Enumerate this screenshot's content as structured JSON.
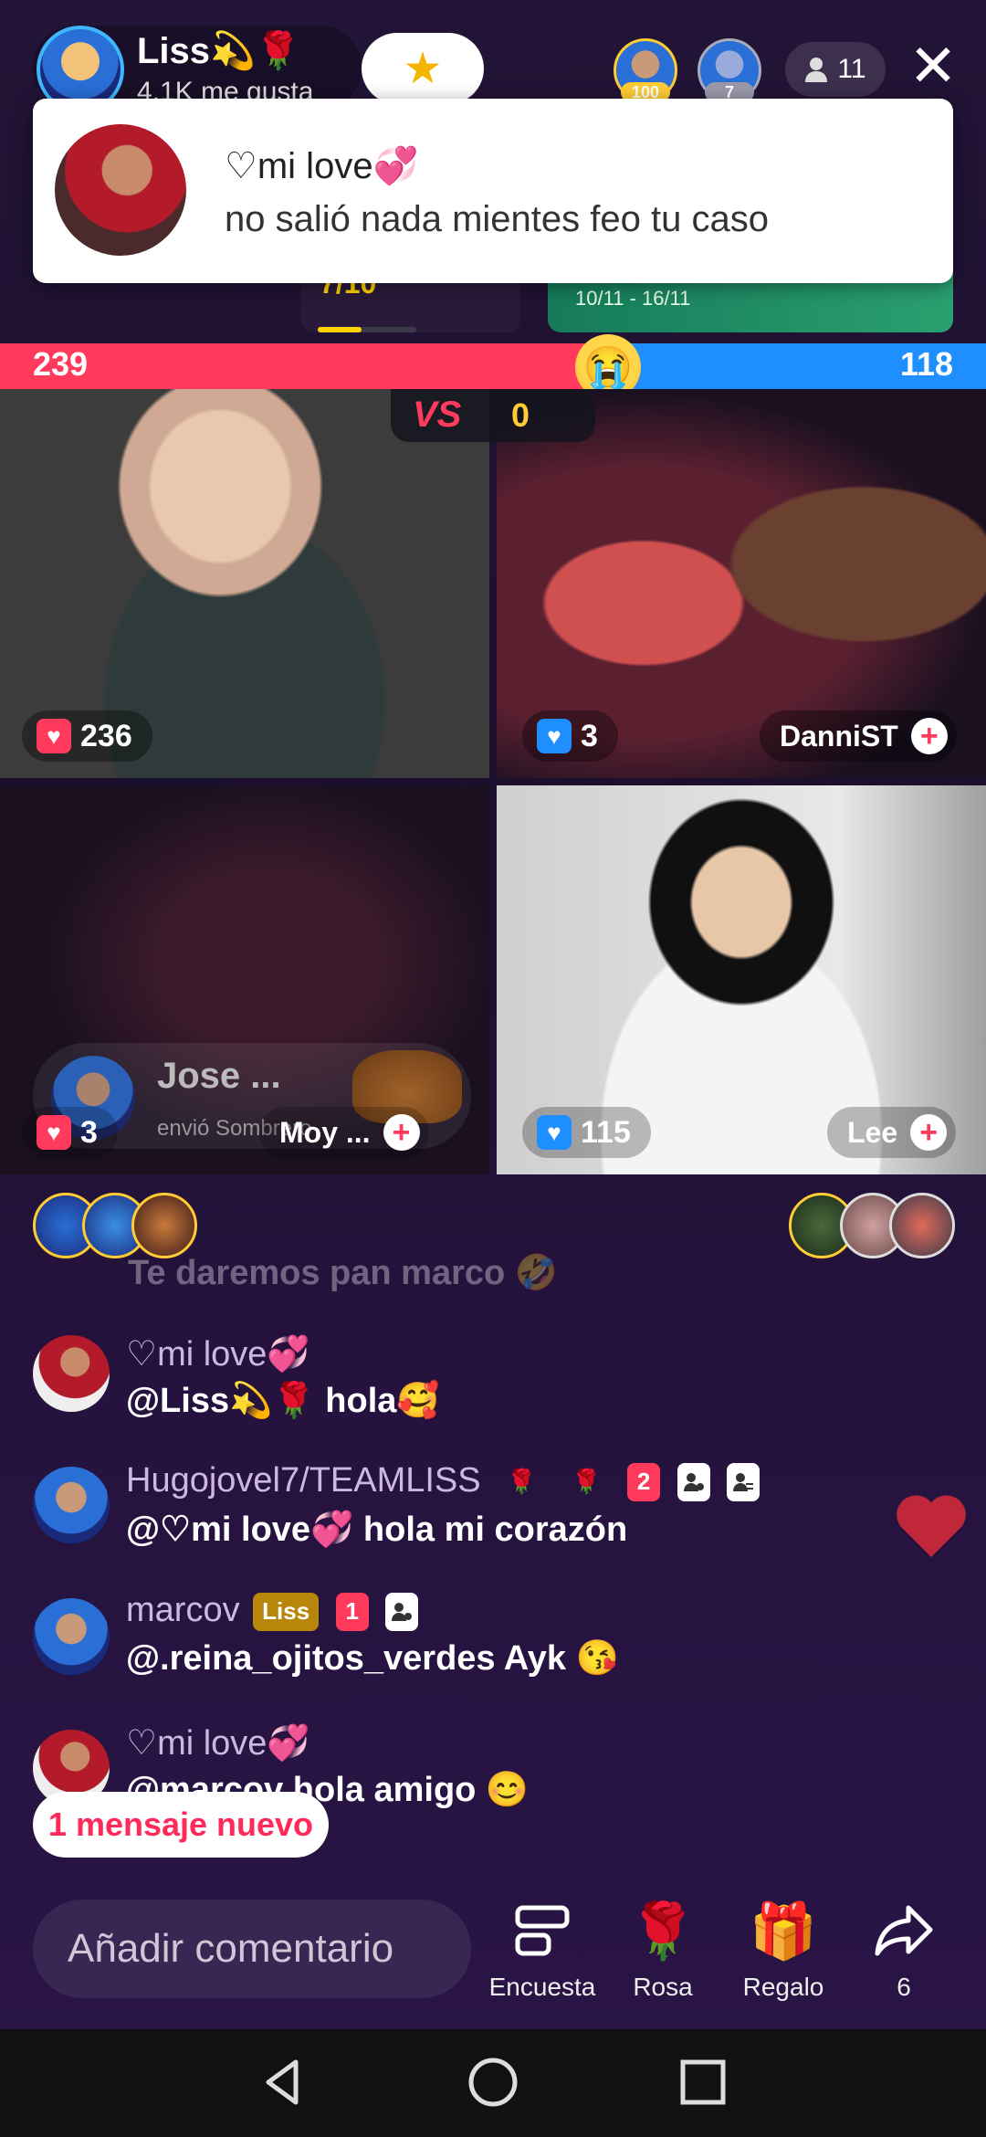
{
  "header": {
    "host_name": "Liss💫🌹",
    "host_likes": "4.1K me gusta",
    "top_gifter_1_badge": "100",
    "top_gifter_2_badge": "7",
    "viewer_count": "11"
  },
  "notification": {
    "user": "♡mi love💞",
    "text": "no salió nada mientes feo tu caso"
  },
  "widgets": {
    "counter": "7/10",
    "banner_date": "10/11 - 16/11"
  },
  "battle": {
    "score_left": "239",
    "score_right": "118",
    "vs_label": "VS",
    "vs_count": "0"
  },
  "tiles": [
    {
      "gift_count": "236",
      "name": ""
    },
    {
      "gift_count": "3",
      "name": "DanniST"
    },
    {
      "gift_count": "3",
      "name": "Moy ..."
    },
    {
      "gift_count": "115",
      "name": "Lee"
    }
  ],
  "gift_toast": {
    "name": "Jose ...",
    "sub": "envió Sombrero"
  },
  "chat": {
    "faded": "Te daremos pan marco 🤣",
    "messages": [
      {
        "user": "♡mi love💞",
        "text": "@Liss💫🌹 hola🥰",
        "badges": []
      },
      {
        "user": "Hugojovel7/TEAMLISS",
        "text": "@♡mi love💞 hola mi corazón",
        "badges": [
          "🌹",
          "🌹",
          "2"
        ]
      },
      {
        "user": "marcov",
        "text": "@.reina_ojitos_verdes Ayk 😘",
        "badges": [
          "Liss",
          "1"
        ]
      },
      {
        "user": "♡mi love💞",
        "text": "@marcov hola amigo 😊",
        "badges": []
      }
    ]
  },
  "new_messages": "1 mensaje nuevo",
  "bottom": {
    "comment_placeholder": "Añadir comentario",
    "poll": "Encuesta",
    "rose": "Rosa",
    "gift": "Regalo",
    "share_count": "6"
  },
  "colors": {
    "battle_red": "#ff3a5c",
    "battle_blue": "#1f8fff",
    "accent_pink": "#ff2a5a"
  }
}
